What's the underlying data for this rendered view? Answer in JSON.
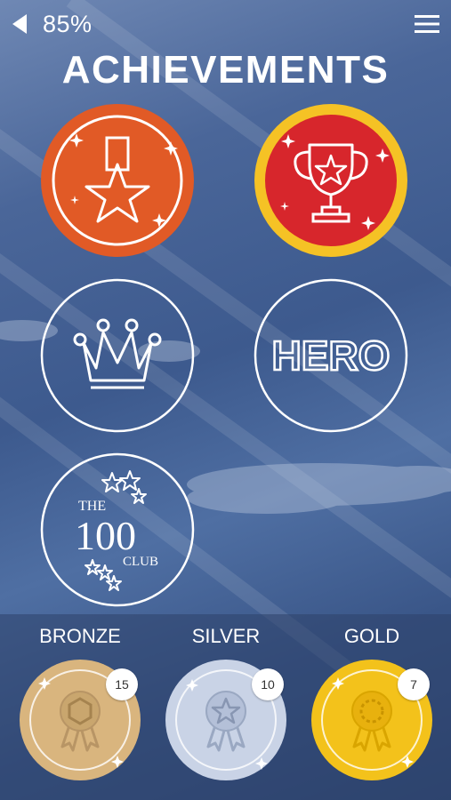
{
  "status": {
    "percent": "85%"
  },
  "header": {
    "title": "ACHIEVEMENTS"
  },
  "badges": [
    {
      "name": "medal-star-badge",
      "earned": true,
      "color": "#e15a26"
    },
    {
      "name": "trophy-badge",
      "earned": true,
      "color": "#d7262c",
      "ring": "#f5c225"
    },
    {
      "name": "crown-badge",
      "earned": false
    },
    {
      "name": "hero-badge",
      "earned": false,
      "text": "HERO"
    },
    {
      "name": "the-100-club-badge",
      "earned": false,
      "text_the": "THE",
      "text_num": "100",
      "text_club": "CLUB"
    }
  ],
  "tiers": [
    {
      "label": "BRONZE",
      "count": "15",
      "color": "#d9b57e"
    },
    {
      "label": "SILVER",
      "count": "10",
      "color": "#c9d3e6"
    },
    {
      "label": "GOLD",
      "count": "7",
      "color": "#f3c21b"
    }
  ]
}
